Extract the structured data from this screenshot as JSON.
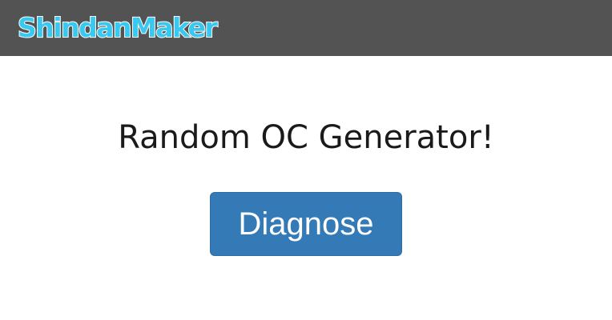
{
  "header": {
    "brand": "ShindanMaker"
  },
  "main": {
    "title": "Random OC Generator!",
    "diagnose_label": "Diagnose"
  },
  "colors": {
    "navbar": "#535353",
    "brand": "#38c8f0",
    "button": "#337ab7"
  }
}
